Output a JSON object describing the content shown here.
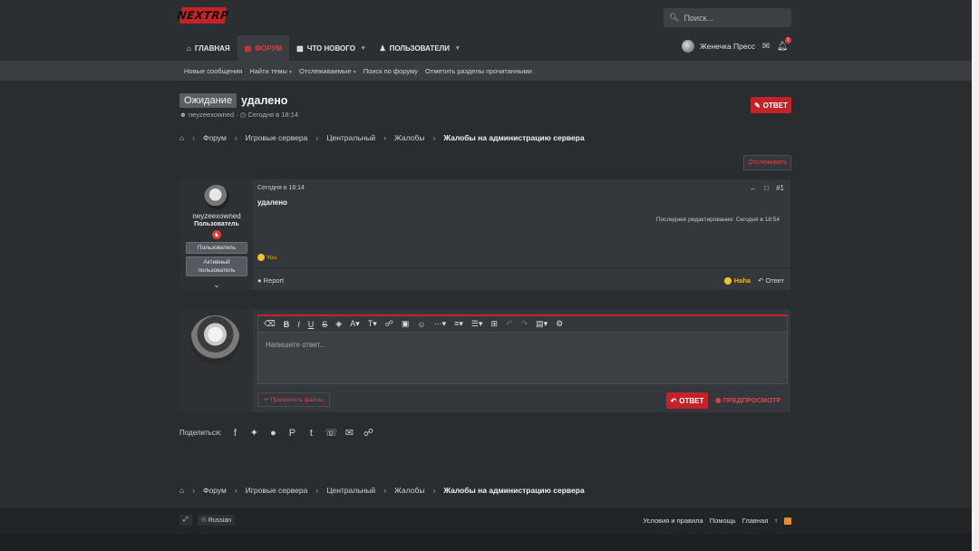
{
  "header": {
    "logo": "NEXTRP",
    "search_placeholder": "Поиск...",
    "user_name": "Женечка Пресс",
    "alerts_count": "1"
  },
  "nav": {
    "items": [
      {
        "label": "ГЛАВНАЯ",
        "icon": "home-icon"
      },
      {
        "label": "ФОРУМ",
        "icon": "forum-icon"
      },
      {
        "label": "ЧТО НОВОГО",
        "icon": "news-icon"
      },
      {
        "label": "ПОЛЬЗОВАТЕЛИ",
        "icon": "users-icon"
      }
    ]
  },
  "subnav": {
    "items": [
      "Новые сообщения",
      "Найти темы",
      "Отслеживаемые",
      "Поиск по форуму",
      "Отметить разделы прочитанными"
    ]
  },
  "thread": {
    "prefix": "Ожидание",
    "title": "удалено",
    "author": "neyzeexowned",
    "date": "Сегодня в 18:14",
    "reply_button": "ОТВЕТ",
    "watch_button": "Отслеживать"
  },
  "breadcrumbs": [
    "Форум",
    "Игровые сервера",
    "Центральный",
    "Жалобы",
    "Жалобы на администрацию сервера"
  ],
  "post": {
    "username": "neyzeexowned",
    "user_title": "Пользователь",
    "banners": [
      "Пользователь",
      "Активный пользователь"
    ],
    "date": "Сегодня в 18:14",
    "number": "#1",
    "content": "удалено",
    "last_edit": "Последнее редактирование: Сегодня в 18:54",
    "reaction_by": "You",
    "report_label": "Report",
    "haha_label": "Haha",
    "reply_label": "Ответ"
  },
  "editor": {
    "placeholder": "Напишите ответ...",
    "attach_label": "Прикрепить файлы",
    "submit_label": "ОТВЕТ",
    "preview_label": "ПРЕДПРОСМОТР"
  },
  "share": {
    "label": "Поделиться:"
  },
  "footer": {
    "language": "Russian",
    "links": [
      "Условия и правила",
      "Помощь",
      "Главная"
    ]
  },
  "colors": {
    "accent": "#c4222a",
    "background": "#2a2d30",
    "panel": "#34373b"
  }
}
